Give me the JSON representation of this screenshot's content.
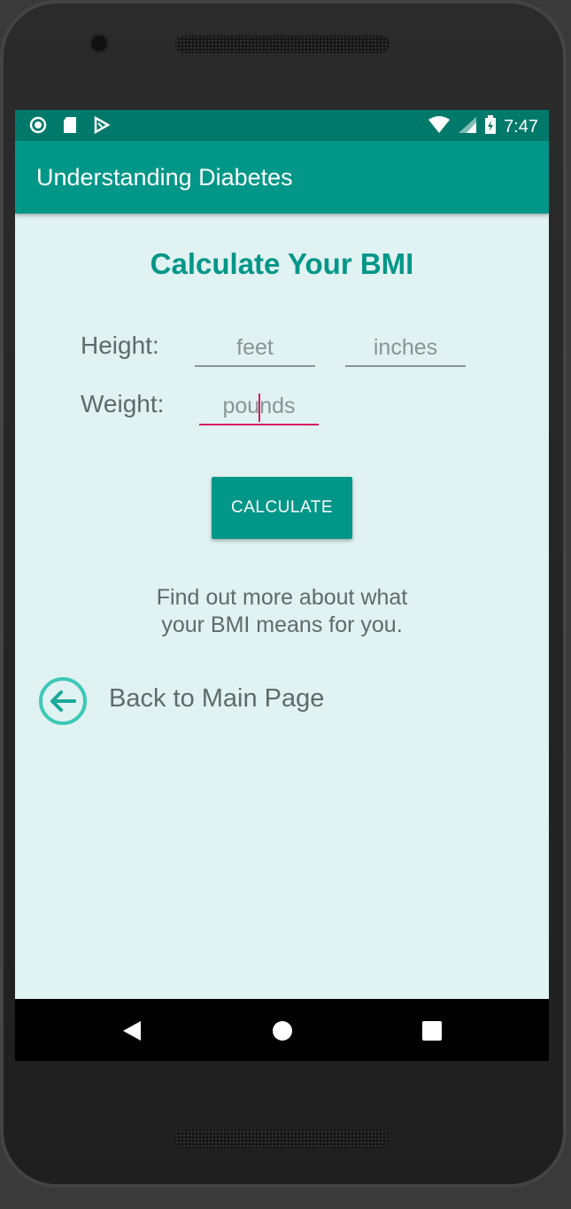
{
  "status_bar": {
    "time": "7:47",
    "left_icons": [
      "circle-notification-icon",
      "sd-card-icon",
      "play-store-icon"
    ],
    "right_icons": [
      "wifi-icon",
      "signal-icon",
      "battery-charging-icon"
    ]
  },
  "app_bar": {
    "title": "Understanding Diabetes"
  },
  "main": {
    "title": "Calculate Your BMI",
    "height_label": "Height:",
    "feet_placeholder": "feet",
    "inches_placeholder": "inches",
    "weight_label": "Weight:",
    "pounds_placeholder": "pounds",
    "calculate_label": "CALCULATE",
    "info_line1": "Find out more about what",
    "info_line2": "your BMI means for you.",
    "back_label": "Back to Main Page"
  },
  "colors": {
    "accent": "#009688",
    "status_bar": "#00796b",
    "background": "#e0f2f1",
    "focus": "#d81b60"
  },
  "nav_bar": {
    "buttons": [
      "back-icon",
      "home-icon",
      "recents-icon"
    ]
  }
}
